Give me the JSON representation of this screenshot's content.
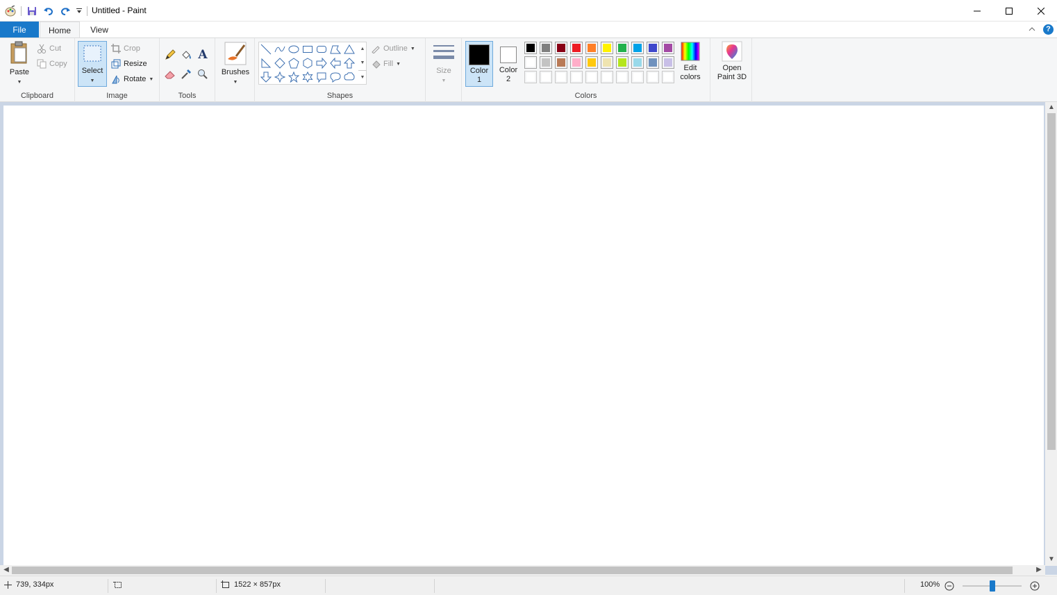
{
  "window": {
    "title": "Untitled - Paint",
    "controls": [
      "minimize-icon",
      "maximize-icon",
      "close-icon"
    ]
  },
  "quick_access": [
    "paint-app-icon",
    "save-icon",
    "undo-icon",
    "redo-icon",
    "customize-icon"
  ],
  "tabs": {
    "file": "File",
    "home": "Home",
    "view": "View"
  },
  "ribbon": {
    "clipboard": {
      "group_label": "Clipboard",
      "paste": "Paste",
      "cut": "Cut",
      "copy": "Copy"
    },
    "image": {
      "group_label": "Image",
      "select": "Select",
      "crop": "Crop",
      "resize": "Resize",
      "rotate": "Rotate"
    },
    "tools": {
      "group_label": "Tools",
      "items": [
        "pencil-icon",
        "fill-bucket-icon",
        "text-icon",
        "eraser-icon",
        "color-picker-icon",
        "magnifier-icon"
      ]
    },
    "brushes": {
      "label": "Brushes"
    },
    "shapes": {
      "group_label": "Shapes",
      "outline": "Outline",
      "fill": "Fill"
    },
    "size": {
      "label": "Size"
    },
    "colors": {
      "group_label": "Colors",
      "color1_label": "Color",
      "color1_num": "1",
      "color2_label": "Color",
      "color2_num": "2",
      "color1_value": "#000000",
      "color2_value": "#ffffff",
      "edit_colors_line1": "Edit",
      "edit_colors_line2": "colors",
      "palette_row1": [
        "#000000",
        "#7f7f7f",
        "#880015",
        "#ed1c24",
        "#ff7f27",
        "#fff200",
        "#22b14c",
        "#00a2e8",
        "#3f48cc",
        "#a349a4"
      ],
      "palette_row2": [
        "#ffffff",
        "#c3c3c3",
        "#b97a57",
        "#ffaec9",
        "#ffc90e",
        "#efe4b0",
        "#b5e61d",
        "#99d9ea",
        "#7092be",
        "#c8bfe7"
      ],
      "palette_row3": [
        "",
        "",
        "",
        "",
        "",
        "",
        "",
        "",
        "",
        ""
      ]
    },
    "paint3d": {
      "line1": "Open",
      "line2": "Paint 3D"
    }
  },
  "status": {
    "cursor_position": "739, 334px",
    "canvas_size": "1522 × 857px",
    "zoom": "100%",
    "zoom_level": 0.5
  }
}
